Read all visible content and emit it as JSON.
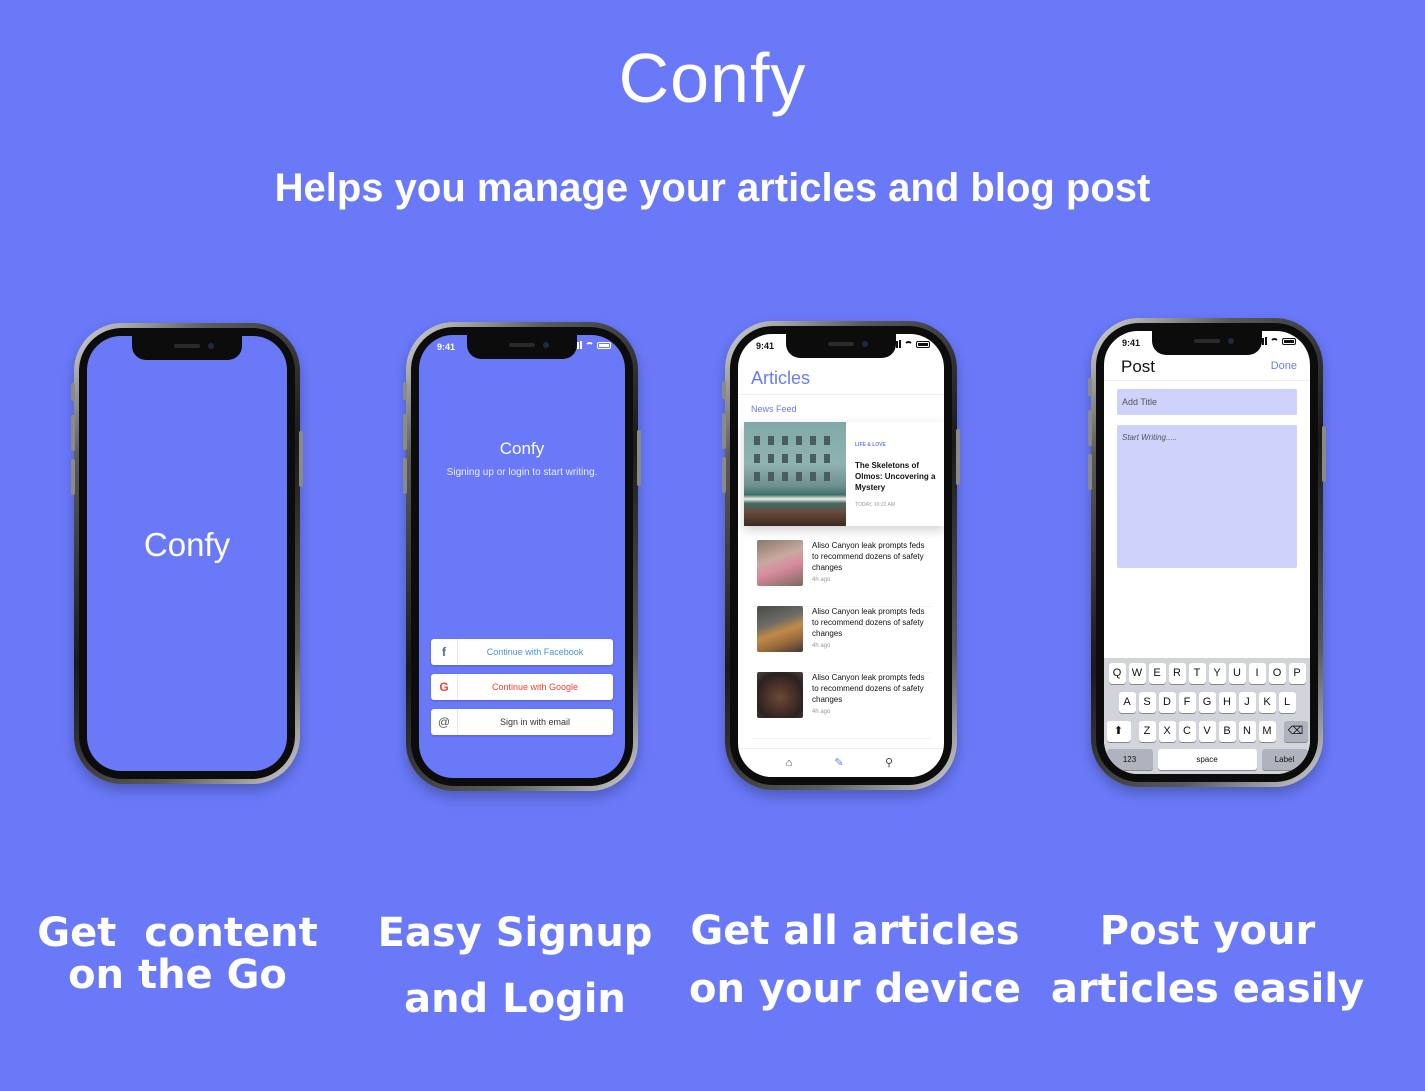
{
  "header": {
    "title": "Confy",
    "subtitle": "Helps you manage your articles and blog post"
  },
  "captions": [
    [
      "Get  content",
      "on the Go"
    ],
    [
      "Easy Signup",
      "and Login"
    ],
    [
      "Get all articles",
      "on your device"
    ],
    [
      "Post your",
      "articles easily"
    ]
  ],
  "colors": {
    "brand": "#6979f8",
    "field": "#cfd2fb",
    "keyboard": "#d1d4db"
  },
  "splash": {
    "logo": "Confy"
  },
  "login": {
    "time": "9:41",
    "app_name": "Confy",
    "tagline": "Signing up or login to start writing.",
    "facebook": {
      "icon": "f",
      "label": "Continue with Facebook"
    },
    "google": {
      "icon": "G",
      "label": "Continue with Google"
    },
    "email": {
      "icon": "@",
      "label": "Sign in with email"
    }
  },
  "articles": {
    "time": "9:41",
    "title": "Articles",
    "section": "News Feed",
    "featured": {
      "category": "LIFE & LOVE",
      "title": "The Skeletons of Olmos: Uncovering a Mystery",
      "date": "TODAY, 10:22 AM"
    },
    "items": [
      {
        "title": "Aliso Canyon leak prompts feds to recommend dozens of safety changes",
        "ago": "4h ago"
      },
      {
        "title": "Aliso Canyon leak prompts feds to recommend dozens of safety changes",
        "ago": "4h ago"
      },
      {
        "title": "Aliso Canyon leak prompts feds to recommend dozens of safety changes",
        "ago": "4h ago"
      }
    ],
    "tabs": [
      "home-icon",
      "edit-icon",
      "profile-icon"
    ]
  },
  "post": {
    "time": "9:41",
    "title": "Post",
    "done": "Done",
    "title_placeholder": "Add Title",
    "body_placeholder": "Start Writing.....",
    "keyboard": {
      "row1": [
        "Q",
        "W",
        "E",
        "R",
        "T",
        "Y",
        "U",
        "I",
        "O",
        "P"
      ],
      "row2": [
        "A",
        "S",
        "D",
        "F",
        "G",
        "H",
        "J",
        "K",
        "L"
      ],
      "row3": [
        "Z",
        "X",
        "C",
        "V",
        "B",
        "N",
        "M"
      ],
      "numbers": "123",
      "space": "space",
      "return": "Label"
    }
  }
}
